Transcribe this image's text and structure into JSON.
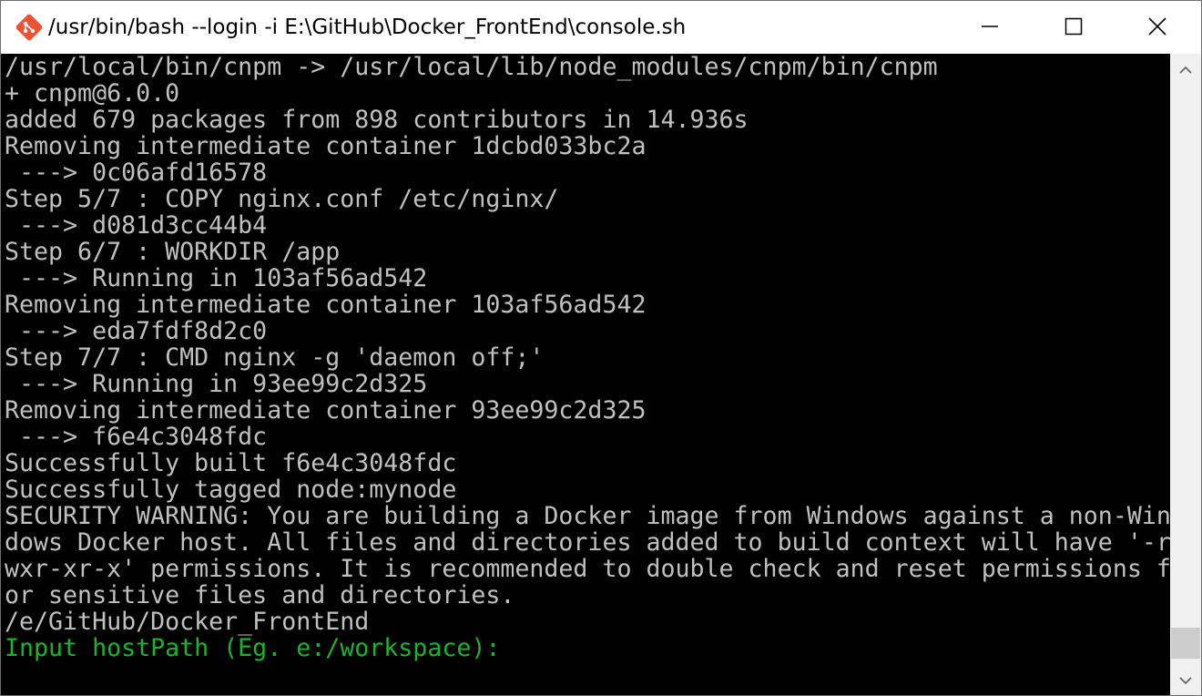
{
  "window": {
    "title": "/usr/bin/bash --login -i E:\\GitHub\\Docker_FrontEnd\\console.sh",
    "icon": "git-bash-icon"
  },
  "controls": {
    "minimize": "minimize-icon",
    "maximize": "maximize-icon",
    "close": "close-icon"
  },
  "terminal": {
    "lines": [
      "/usr/local/bin/cnpm -> /usr/local/lib/node_modules/cnpm/bin/cnpm",
      "+ cnpm@6.0.0",
      "added 679 packages from 898 contributors in 14.936s",
      "Removing intermediate container 1dcbd033bc2a",
      " ---> 0c06afd16578",
      "Step 5/7 : COPY nginx.conf /etc/nginx/",
      " ---> d081d3cc44b4",
      "Step 6/7 : WORKDIR /app",
      " ---> Running in 103af56ad542",
      "Removing intermediate container 103af56ad542",
      " ---> eda7fdf8d2c0",
      "Step 7/7 : CMD nginx -g 'daemon off;'",
      " ---> Running in 93ee99c2d325",
      "Removing intermediate container 93ee99c2d325",
      " ---> f6e4c3048fdc",
      "Successfully built f6e4c3048fdc",
      "Successfully tagged node:mynode",
      "SECURITY WARNING: You are building a Docker image from Windows against a non-Win",
      "dows Docker host. All files and directories added to build context will have '-r",
      "wxr-xr-x' permissions. It is recommended to double check and reset permissions f",
      "or sensitive files and directories.",
      "/e/GitHub/Docker_FrontEnd",
      "Input hostPath (Eg. e:/workspace):"
    ],
    "prompt_color": "#1bb32b",
    "text_color": "#c0c0c0",
    "background": "#000000"
  },
  "scrollbar": {
    "up_icon": "scroll-up-arrow-icon",
    "down_icon": "scroll-down-arrow-icon"
  }
}
